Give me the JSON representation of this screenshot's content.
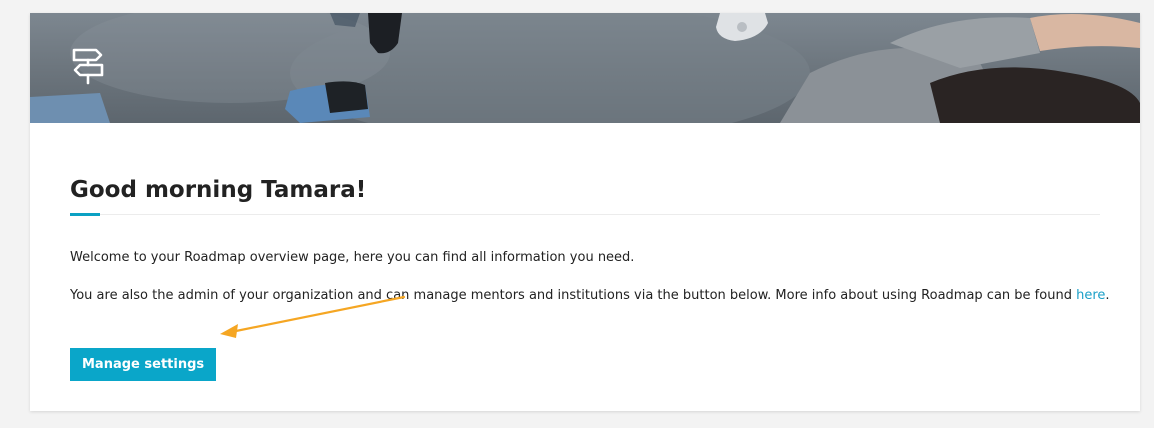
{
  "banner": {
    "logo_icon": "signpost-icon"
  },
  "welcome": {
    "greeting": "Good morning Tamara!",
    "intro": "Welcome to your Roadmap overview page, here you can find all information you need.",
    "admin_text": "You are also the admin of your organization and can manage mentors and institutions via the button below. More info about using Roadmap can be found ",
    "link_label": "here",
    "trailing_period": ".",
    "button_label": "Manage settings"
  },
  "colors": {
    "accent": "#0aa6c9",
    "link": "#1a9fc7",
    "annotation_arrow": "#f5a623"
  }
}
